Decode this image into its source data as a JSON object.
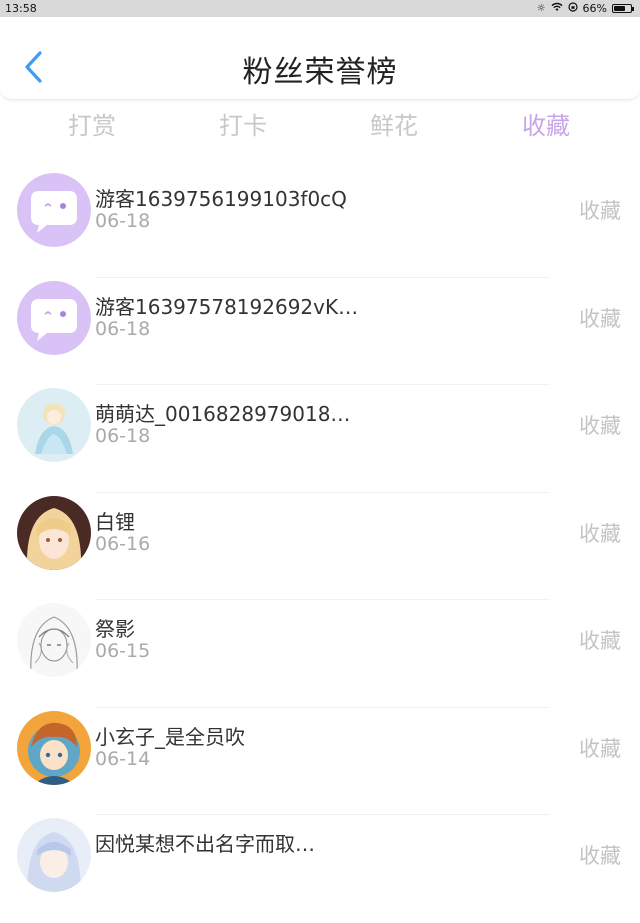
{
  "status_bar": {
    "time": "13:58",
    "battery": "66%",
    "battery_level": 0.66,
    "icons": [
      "brightness-icon",
      "wifi-icon",
      "rotation-lock-icon",
      "battery-icon"
    ]
  },
  "header": {
    "title": "粉丝荣誉榜",
    "back_icon": "chevron-left-icon",
    "accent_color": "#3f9cf0"
  },
  "tabs": [
    {
      "label": "打赏",
      "active": false
    },
    {
      "label": "打卡",
      "active": false
    },
    {
      "label": "鲜花",
      "active": false
    },
    {
      "label": "收藏",
      "active": true
    }
  ],
  "colors": {
    "tab_active": "#c9a6e8",
    "tab_inactive": "#c8c8c8",
    "action": "#c4c4c4"
  },
  "fans": [
    {
      "name": "游客1639756199103f0cQ",
      "date": "06-18",
      "action": "收藏",
      "avatar": "default-chat-avatar"
    },
    {
      "name": "游客16397578192692vK…",
      "date": "06-18",
      "action": "收藏",
      "avatar": "default-chat-avatar"
    },
    {
      "name": "萌萌达_0016828979018…",
      "date": "06-18",
      "action": "收藏",
      "avatar": "anime-girl-blue-dress-avatar"
    },
    {
      "name": "白锂",
      "date": "06-16",
      "action": "收藏",
      "avatar": "anime-blonde-girl-avatar"
    },
    {
      "name": "祭影",
      "date": "06-15",
      "action": "收藏",
      "avatar": "sketch-girl-avatar"
    },
    {
      "name": "小玄子_是全员吹",
      "date": "06-14",
      "action": "收藏",
      "avatar": "anime-boy-orange-avatar"
    },
    {
      "name": "因悦某想不出名字而取…",
      "date": "",
      "action": "收藏",
      "avatar": "anime-girl-silver-hair-avatar"
    }
  ]
}
